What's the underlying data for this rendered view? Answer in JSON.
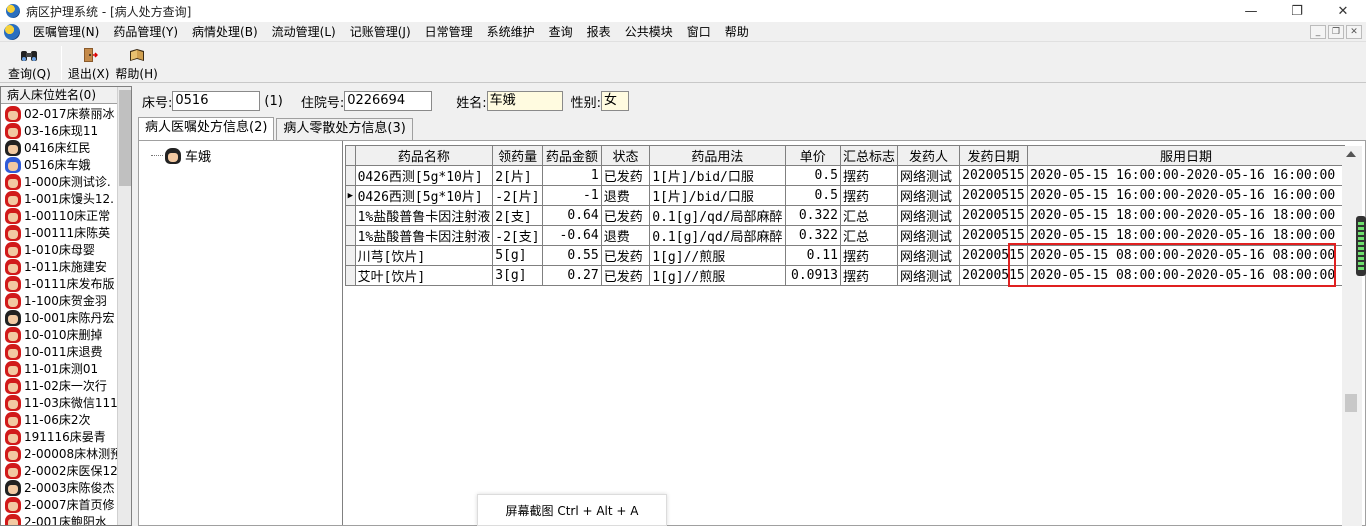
{
  "window": {
    "title": "病区护理系统 - [病人处方查询]"
  },
  "menu": [
    "医嘱管理(N)",
    "药品管理(Y)",
    "病情处理(B)",
    "流动管理(L)",
    "记账管理(J)",
    "日常管理",
    "系统维护",
    "查询",
    "报表",
    "公共模块",
    "窗口",
    "帮助"
  ],
  "toolbar": {
    "query": "查询(Q)",
    "exit": "退出(X)",
    "help": "帮助(H)"
  },
  "left_panel": {
    "header": "病人床位姓名(0)",
    "beds": [
      {
        "label": "02-017床蔡丽冰",
        "icon": "red"
      },
      {
        "label": "03-16床现11",
        "icon": "red"
      },
      {
        "label": "0416床红民",
        "icon": "plain"
      },
      {
        "label": "0516床车娥",
        "icon": "blue"
      },
      {
        "label": "1-000床测试诊.",
        "icon": "red"
      },
      {
        "label": "1-001床馒头12.",
        "icon": "red"
      },
      {
        "label": "1-00110床正常",
        "icon": "red"
      },
      {
        "label": "1-00111床陈英",
        "icon": "red"
      },
      {
        "label": "1-010床母婴",
        "icon": "red"
      },
      {
        "label": "1-011床施建安",
        "icon": "red"
      },
      {
        "label": "1-0111床发布版",
        "icon": "red"
      },
      {
        "label": "1-100床贺金羽",
        "icon": "red"
      },
      {
        "label": "10-001床陈丹宏",
        "icon": "plain"
      },
      {
        "label": "10-010床删掉",
        "icon": "red"
      },
      {
        "label": "10-011床退费",
        "icon": "red"
      },
      {
        "label": "11-01床测01",
        "icon": "red"
      },
      {
        "label": "11-02床一次行",
        "icon": "red"
      },
      {
        "label": "11-03床微信111",
        "icon": "red"
      },
      {
        "label": "11-06床2次",
        "icon": "red"
      },
      {
        "label": "191116床晏青",
        "icon": "red"
      },
      {
        "label": "2-00008床林测预",
        "icon": "red"
      },
      {
        "label": "2-0002床医保12",
        "icon": "red"
      },
      {
        "label": "2-0003床陈俊杰",
        "icon": "plain"
      },
      {
        "label": "2-0007床首页修",
        "icon": "red"
      },
      {
        "label": "2-001床鲍阳水",
        "icon": "red"
      }
    ]
  },
  "patient": {
    "bed_label": "床号:",
    "bed_no": "0516",
    "count": "(1)",
    "admission_label": "住院号:",
    "admission_no": "0226694",
    "name_label": "姓名:",
    "name": "车娥",
    "sex_label": "性别:",
    "sex": "女"
  },
  "tabs": [
    "病人医嘱处方信息(2)",
    "病人零散处方信息(3)"
  ],
  "tree": {
    "node": "车娥"
  },
  "grid": {
    "columns": [
      "药品名称",
      "领药量",
      "药品金额",
      "状态",
      "药品用法",
      "单价",
      "汇总标志",
      "发药人",
      "发药日期",
      "服用日期"
    ],
    "rows": [
      [
        "0426西测[5g*10片]",
        "2[片]",
        "1",
        "已发药",
        "1[片]/bid/口服",
        "0.5",
        "摆药",
        "网络测试",
        "20200515",
        "2020-05-15 16:00:00-2020-05-16 16:00:00"
      ],
      [
        "0426西测[5g*10片]",
        "-2[片]",
        "-1",
        "退费",
        "1[片]/bid/口服",
        "0.5",
        "摆药",
        "网络测试",
        "20200515",
        "2020-05-15 16:00:00-2020-05-16 16:00:00"
      ],
      [
        "1%盐酸普鲁卡因注射液",
        "2[支]",
        "0.64",
        "已发药",
        "0.1[g]/qd/局部麻醉",
        "0.322",
        "汇总",
        "网络测试",
        "20200515",
        "2020-05-15 18:00:00-2020-05-16 18:00:00"
      ],
      [
        "1%盐酸普鲁卡因注射液",
        "-2[支]",
        "-0.64",
        "退费",
        "0.1[g]/qd/局部麻醉",
        "0.322",
        "汇总",
        "网络测试",
        "20200515",
        "2020-05-15 18:00:00-2020-05-16 18:00:00"
      ],
      [
        "川芎[饮片]",
        "5[g]",
        "0.55",
        "已发药",
        "1[g]//煎服",
        "0.11",
        "摆药",
        "网络测试",
        "20200515",
        "2020-05-15 08:00:00-2020-05-16 08:00:00"
      ],
      [
        "艾叶[饮片]",
        "3[g]",
        "0.27",
        "已发药",
        "1[g]//煎服",
        "0.0913",
        "摆药",
        "网络测试",
        "20200515",
        "2020-05-15 08:00:00-2020-05-16 08:00:00"
      ]
    ],
    "current_row": 1
  },
  "tooltip": "屏幕截图 Ctrl + Alt + A"
}
